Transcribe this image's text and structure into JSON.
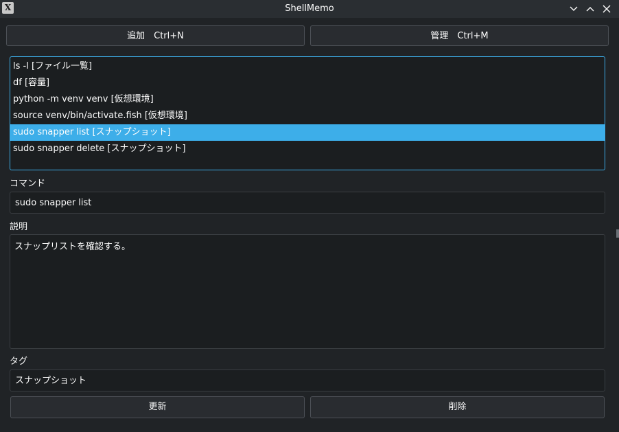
{
  "window": {
    "title": "ShellMemo",
    "icon": "x11-app-icon"
  },
  "toolbar": {
    "add_label": "追加　Ctrl+N",
    "manage_label": "管理　Ctrl+M"
  },
  "commands": {
    "items": [
      {
        "label": "ls -l [ファイル一覧]",
        "selected": false
      },
      {
        "label": "df [容量]",
        "selected": false
      },
      {
        "label": "python -m venv venv [仮想環境]",
        "selected": false
      },
      {
        "label": "source venv/bin/activate.fish [仮想環境]",
        "selected": false
      },
      {
        "label": "sudo snapper list [スナップショット]",
        "selected": true
      },
      {
        "label": "sudo snapper delete [スナップショット]",
        "selected": false
      }
    ]
  },
  "form": {
    "command_label": "コマンド",
    "command_value": "sudo snapper list",
    "description_label": "説明",
    "description_value": "スナップリストを確認する。",
    "tag_label": "タグ",
    "tag_value": "スナップショット"
  },
  "actions": {
    "update_label": "更新",
    "delete_label": "削除"
  },
  "colors": {
    "accent": "#3daee9",
    "background": "#202326",
    "field_background": "#1b1e20",
    "text": "#fcfcfc"
  }
}
